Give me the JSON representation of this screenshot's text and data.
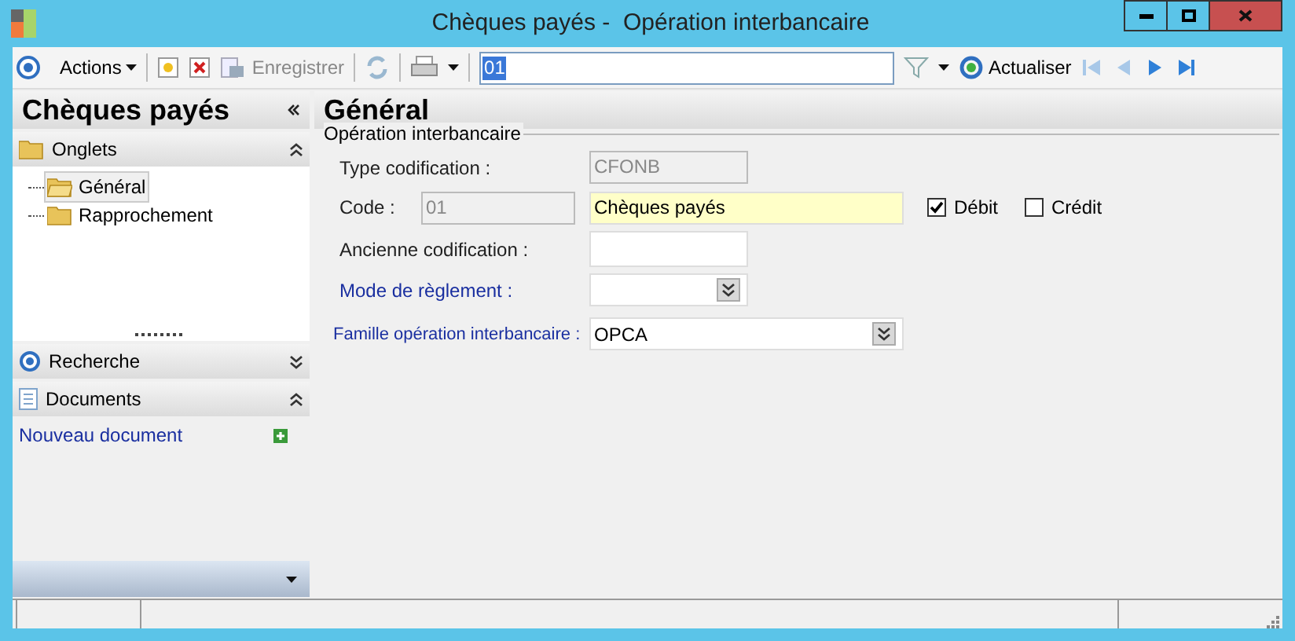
{
  "window": {
    "title": "Chèques payés -  Opération interbancaire"
  },
  "toolbar": {
    "actions_label": "Actions",
    "save_label": "Enregistrer",
    "search_value": "01",
    "refresh_label": "Actualiser"
  },
  "sidebar": {
    "title": "Chèques payés",
    "sections": [
      {
        "kind": "tree",
        "label": "Onglets",
        "expanded": true,
        "items": [
          {
            "label": "Général",
            "selected": true
          },
          {
            "label": "Rapprochement",
            "selected": false
          }
        ]
      },
      {
        "kind": "search",
        "label": "Recherche",
        "expanded": false
      },
      {
        "kind": "documents",
        "label": "Documents",
        "expanded": true,
        "link": "Nouveau document"
      }
    ]
  },
  "content": {
    "title": "Général",
    "group_title": "Opération interbancaire",
    "type_codification": {
      "label": "Type codification :",
      "value": "CFONB",
      "disabled": true
    },
    "code": {
      "label": "Code :",
      "value": "01",
      "disabled": true,
      "name": "Chèques payés"
    },
    "checkboxes": [
      {
        "label": "Débit",
        "checked": true
      },
      {
        "label": "Crédit",
        "checked": false
      }
    ],
    "ancienne_codification": {
      "label": "Ancienne codification :"
    },
    "mode_de_reglement": {
      "label": "Mode de règlement :"
    },
    "famille": {
      "label": "Famille opération interbancaire :",
      "value": "OPCA"
    }
  }
}
